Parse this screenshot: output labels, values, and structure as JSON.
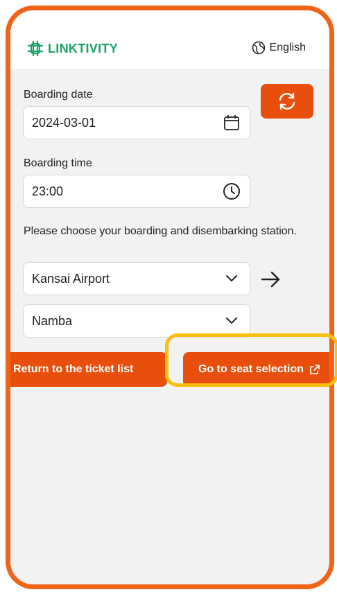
{
  "header": {
    "brand": "LINKTIVITY",
    "language": "English"
  },
  "form": {
    "boarding_date_label": "Boarding date",
    "boarding_date_value": "2024-03-01",
    "boarding_time_label": "Boarding time",
    "boarding_time_value": "23:00",
    "station_note": "Please choose your boarding and disembarking station.",
    "from_station": "Kansai Airport",
    "to_station": "Namba"
  },
  "actions": {
    "return_label": "Return to the ticket list",
    "seat_label": "Go to seat selection"
  },
  "colors": {
    "accent": "#e84f0c",
    "frame": "#f0641a",
    "brand": "#1aa366",
    "highlight": "#fbbf0f"
  }
}
